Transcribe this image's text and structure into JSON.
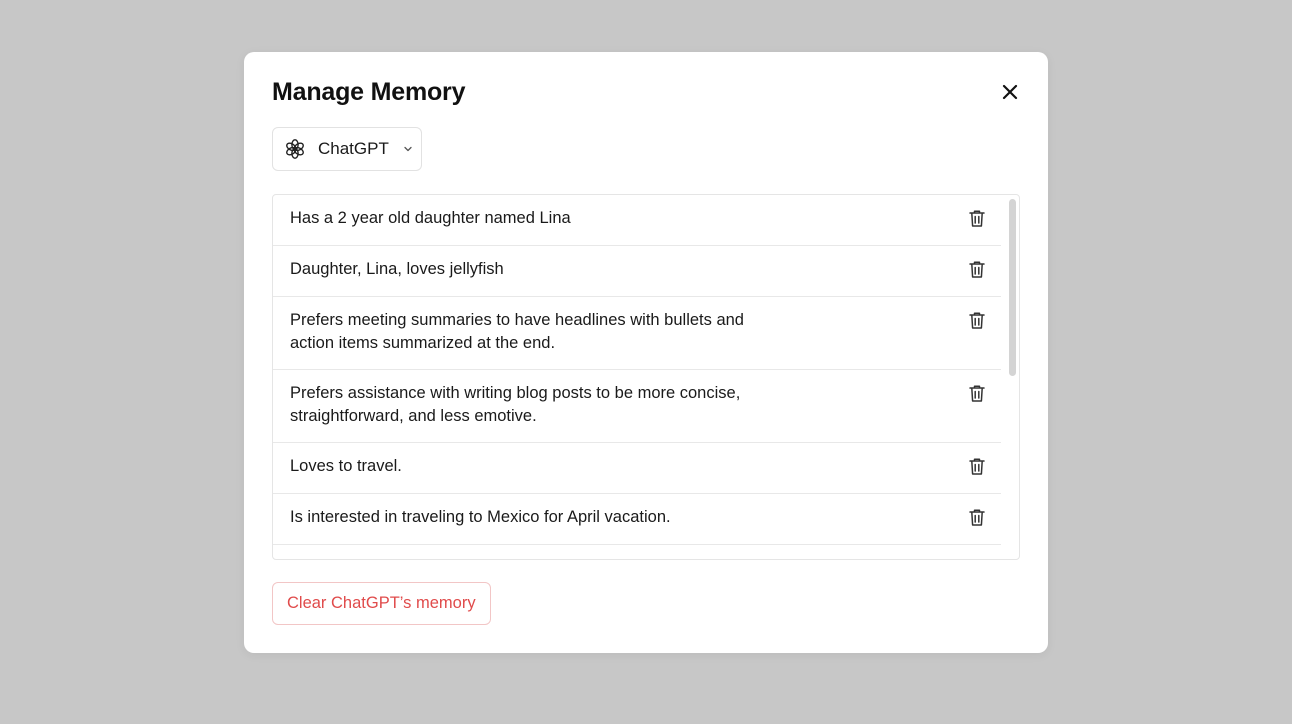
{
  "modal": {
    "title": "Manage Memory",
    "close_icon": "close-icon"
  },
  "selector": {
    "icon": "openai-logo-icon",
    "label": "ChatGPT",
    "chevron_icon": "chevron-down-icon"
  },
  "memories": [
    {
      "text": "Has a 2 year old daughter named Lina"
    },
    {
      "text": "Daughter, Lina, loves jellyfish"
    },
    {
      "text": "Prefers meeting summaries to have headlines with bullets and action items summarized at the end."
    },
    {
      "text": "Prefers assistance with writing blog posts to be more concise, straightforward, and less emotive."
    },
    {
      "text": "Loves to travel."
    },
    {
      "text": "Is interested in traveling to Mexico for April vacation."
    },
    {
      "text": ""
    }
  ],
  "row_action_icon": "trash-icon",
  "clear_button": {
    "label": "Clear ChatGPT’s memory"
  },
  "colors": {
    "overlay": "#c7c7c7",
    "danger": "#e04b4b",
    "danger_border": "#f2c6c6"
  }
}
